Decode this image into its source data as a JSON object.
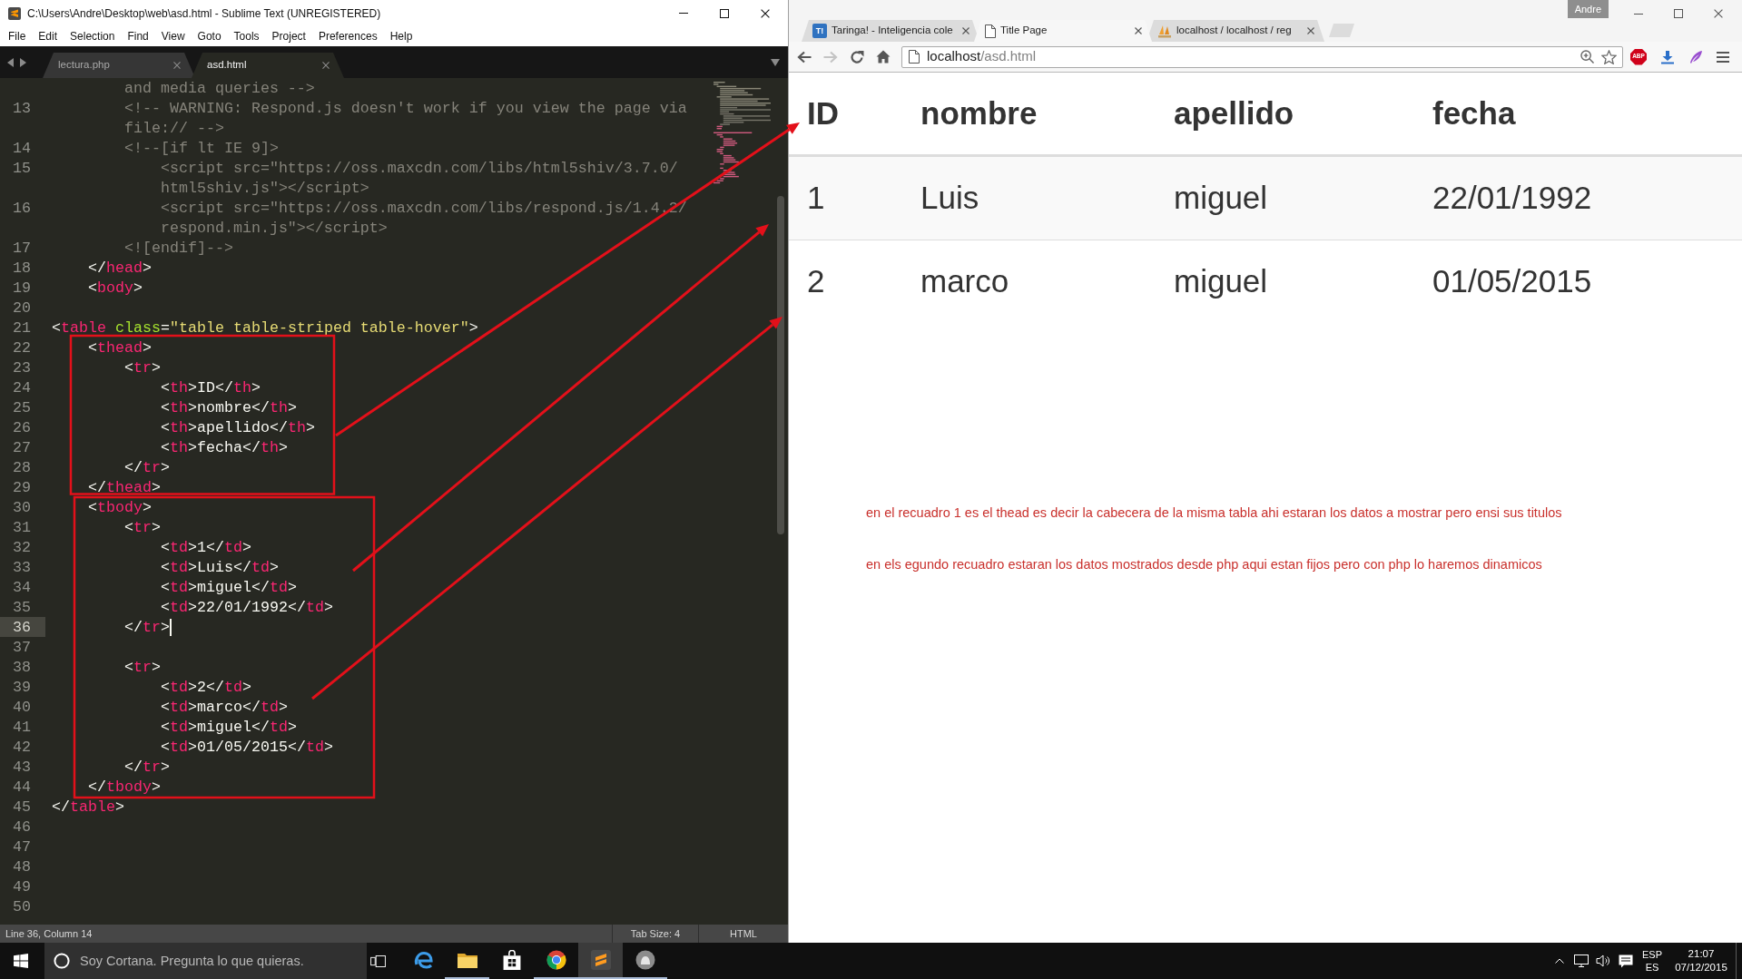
{
  "editor": {
    "title": "C:\\Users\\Andre\\Desktop\\web\\asd.html - Sublime Text (UNREGISTERED)",
    "menu": [
      "File",
      "Edit",
      "Selection",
      "Find",
      "View",
      "Goto",
      "Tools",
      "Project",
      "Preferences",
      "Help"
    ],
    "tabs": [
      {
        "label": "lectura.php",
        "selected": false
      },
      {
        "label": "asd.html",
        "selected": true
      }
    ],
    "rows": [
      {
        "kind": "comment",
        "current": false,
        "code": "        and media queries -->"
      },
      {
        "number": "13",
        "kind": "comment",
        "current": false,
        "code": "        <!-- WARNING: Respond.js doesn't work if you view the page via"
      },
      {
        "kind": "comment",
        "current": false,
        "code": "        file:// -->"
      },
      {
        "number": "14",
        "kind": "comment",
        "current": false,
        "code": "        <!--[if lt IE 9]>"
      },
      {
        "number": "15",
        "kind": "comment",
        "current": false,
        "code": "            <script src=\"https://oss.maxcdn.com/libs/html5shiv/3.7.0/"
      },
      {
        "kind": "comment",
        "current": false,
        "code": "            html5shiv.js\"></script>"
      },
      {
        "number": "16",
        "kind": "comment",
        "current": false,
        "code": "            <script src=\"https://oss.maxcdn.com/libs/respond.js/1.4.2/"
      },
      {
        "kind": "comment",
        "current": false,
        "code": "            respond.min.js\"></script>"
      },
      {
        "number": "17",
        "kind": "comment",
        "current": false,
        "code": "        <![endif]-->"
      },
      {
        "number": "18",
        "kind": "markup",
        "current": false,
        "code": "    </head>"
      },
      {
        "number": "19",
        "kind": "markup",
        "current": false,
        "code": "    <body>"
      },
      {
        "number": "20",
        "current": false
      },
      {
        "number": "21",
        "kind": "markup",
        "current": false,
        "code": "<table class=\"table table-striped table-hover\">"
      },
      {
        "number": "22",
        "kind": "markup",
        "current": false,
        "code": "    <thead>"
      },
      {
        "number": "23",
        "kind": "markup",
        "current": false,
        "code": "        <tr>"
      },
      {
        "number": "24",
        "kind": "markup",
        "current": false,
        "code": "            <th>ID</th>"
      },
      {
        "number": "25",
        "kind": "markup",
        "current": false,
        "code": "            <th>nombre</th>"
      },
      {
        "number": "26",
        "kind": "markup",
        "current": false,
        "code": "            <th>apellido</th>"
      },
      {
        "number": "27",
        "kind": "markup",
        "current": false,
        "code": "            <th>fecha</th>"
      },
      {
        "number": "28",
        "kind": "markup",
        "current": false,
        "code": "        </tr>"
      },
      {
        "number": "29",
        "kind": "markup",
        "current": false,
        "code": "    </thead>"
      },
      {
        "number": "30",
        "kind": "markup",
        "current": false,
        "code": "    <tbody>"
      },
      {
        "number": "31",
        "kind": "markup",
        "current": false,
        "code": "        <tr>"
      },
      {
        "number": "32",
        "kind": "markup",
        "current": false,
        "code": "            <td>1</td>"
      },
      {
        "number": "33",
        "kind": "markup",
        "current": false,
        "code": "            <td>Luis</td>"
      },
      {
        "number": "34",
        "kind": "markup",
        "current": false,
        "code": "            <td>miguel</td>"
      },
      {
        "number": "35",
        "kind": "markup",
        "current": false,
        "code": "            <td>22/01/1992</td>"
      },
      {
        "number": "36",
        "kind": "markup",
        "current": true,
        "code": "        </tr>"
      },
      {
        "number": "37",
        "current": false
      },
      {
        "number": "38",
        "kind": "markup",
        "current": false,
        "code": "        <tr>"
      },
      {
        "number": "39",
        "kind": "markup",
        "current": false,
        "code": "            <td>2</td>"
      },
      {
        "number": "40",
        "kind": "markup",
        "current": false,
        "code": "            <td>marco</td>"
      },
      {
        "number": "41",
        "kind": "markup",
        "current": false,
        "code": "            <td>miguel</td>"
      },
      {
        "number": "42",
        "kind": "markup",
        "current": false,
        "code": "            <td>01/05/2015</td>"
      },
      {
        "number": "43",
        "kind": "markup",
        "current": false,
        "code": "        </tr>"
      },
      {
        "number": "44",
        "kind": "markup",
        "current": false,
        "code": "    </tbody>"
      },
      {
        "number": "45",
        "kind": "markup",
        "current": false,
        "code": "</table>"
      },
      {
        "number": "46",
        "current": false
      },
      {
        "number": "47",
        "current": false
      },
      {
        "number": "48",
        "current": false
      },
      {
        "number": "49",
        "current": false
      },
      {
        "number": "50",
        "current": false
      }
    ],
    "status_bar": {
      "position": "Line 36, Column 14",
      "tab_size": "Tab Size: 4",
      "syntax": "HTML"
    }
  },
  "browser": {
    "profile": "Andre",
    "tabs": [
      {
        "kind": "badge",
        "icon_text": "T!",
        "title": "Taringa! - Inteligencia cole",
        "selected": false
      },
      {
        "kind": "page",
        "title": "Title Page",
        "selected": true
      },
      {
        "kind": "sails",
        "title": "localhost / localhost / reg",
        "selected": false
      }
    ],
    "nav": [
      {
        "kind": "back",
        "disabled": false
      },
      {
        "kind": "forward",
        "disabled": true
      },
      {
        "kind": "reload",
        "disabled": false
      },
      {
        "kind": "home",
        "disabled": false
      }
    ],
    "address": {
      "host": "localhost",
      "path": "/asd.html"
    },
    "extensions": [
      {
        "kind": "adblock",
        "label": "ABP"
      },
      {
        "kind": "download"
      },
      {
        "kind": "feather"
      }
    ],
    "table": {
      "columns": [
        "ID",
        "nombre",
        "apellido",
        "fecha"
      ],
      "rows": [
        [
          "1",
          "Luis",
          "miguel",
          "22/01/1992"
        ],
        [
          "2",
          "marco",
          "miguel",
          "01/05/2015"
        ]
      ]
    },
    "notes": [
      "en el recuadro 1 es el thead es decir la cabecera de la misma tabla ahi estaran los datos a mostrar pero ensi sus titulos",
      "en els egundo recuadro estaran los datos mostrados desde php aqui estan fijos pero con php lo haremos dinamicos"
    ]
  },
  "taskbar": {
    "search": {
      "placeholder": "Soy Cortana. Pregunta lo que quieras."
    },
    "apps": [
      {
        "kind": "swirl",
        "selected": false,
        "running": false
      },
      {
        "kind": "folder",
        "selected": false,
        "running": true
      },
      {
        "kind": "bag",
        "selected": false,
        "running": false
      },
      {
        "kind": "wheel",
        "selected": false,
        "running": true
      },
      {
        "kind": "tile",
        "selected": true,
        "running": true
      },
      {
        "kind": "round",
        "selected": false,
        "running": true
      }
    ],
    "tray": {
      "language": "ESP",
      "layout": "ES",
      "time": "21:07",
      "date": "07/12/2015"
    }
  }
}
